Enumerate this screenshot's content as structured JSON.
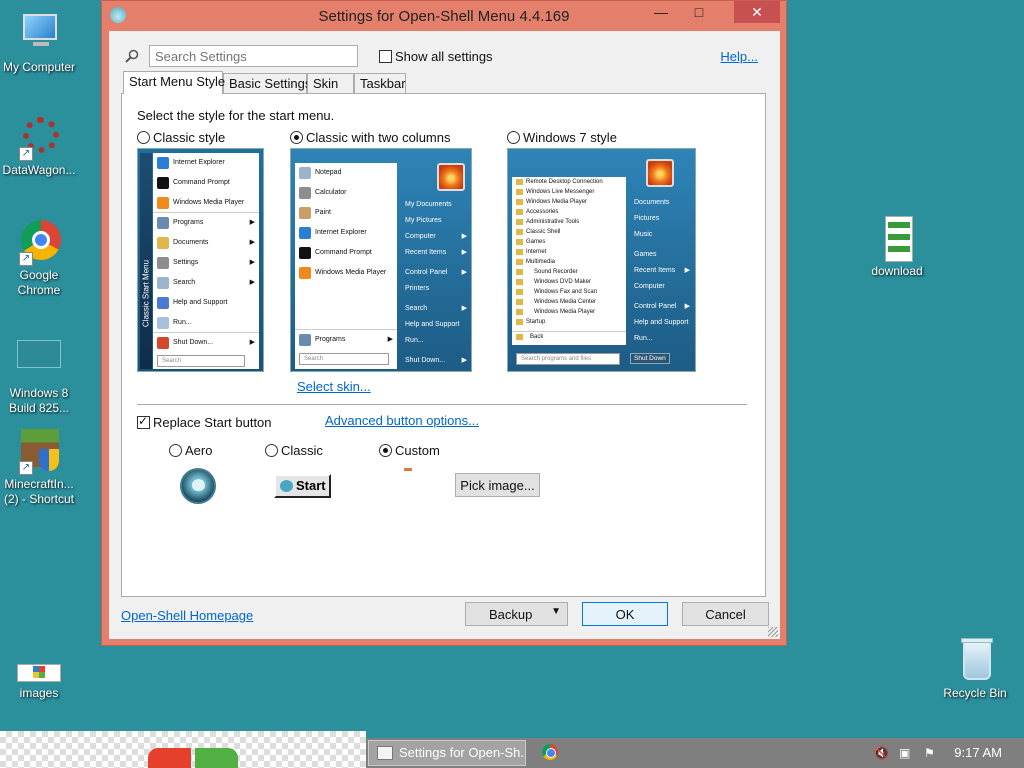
{
  "window": {
    "title": "Settings for Open-Shell Menu 4.4.169",
    "min_label": "—",
    "max_label": "□",
    "close_label": "✕"
  },
  "search": {
    "placeholder": "Search Settings"
  },
  "show_all": {
    "label": "Show all settings",
    "checked": false
  },
  "help_link": "Help...",
  "tabs": [
    {
      "label": "Start Menu Style",
      "active": true
    },
    {
      "label": "Basic Settings",
      "active": false
    },
    {
      "label": "Skin",
      "active": false
    },
    {
      "label": "Taskbar",
      "active": false
    }
  ],
  "style_prompt": "Select the style for the start menu.",
  "styles": [
    {
      "label": "Classic style",
      "selected": false
    },
    {
      "label": "Classic with two columns",
      "selected": true
    },
    {
      "label": "Windows 7 style",
      "selected": false
    }
  ],
  "preview_classic": {
    "side_label": "Classic Start Menu",
    "items": [
      "Internet Explorer",
      "Command Prompt",
      "Windows Media Player",
      "Programs",
      "Documents",
      "Settings",
      "Search",
      "Help and Support",
      "Run...",
      "Shut Down..."
    ],
    "search": "Search"
  },
  "preview_two_col": {
    "left_items": [
      "Notepad",
      "Calculator",
      "Paint",
      "Internet Explorer",
      "Command Prompt",
      "Windows Media Player"
    ],
    "programs": "Programs",
    "right_items": [
      "My Documents",
      "My Pictures",
      "Computer",
      "Recent Items",
      "Control Panel",
      "Printers",
      "Search",
      "Help and Support",
      "Run...",
      "Shut Down..."
    ],
    "search": "Search"
  },
  "preview_win7": {
    "left_items": [
      "Remote Desktop Connection",
      "Windows Live Messenger",
      "Windows Media Player",
      "Accessories",
      "Administrative Tools",
      "Classic Shell",
      "Games",
      "Internet",
      "Multimedia",
      "Sound Recorder",
      "Windows DVD Maker",
      "Windows Fax and Scan",
      "Windows Media Center",
      "Windows Media Player",
      "Startup"
    ],
    "back": "Back",
    "search": "Search programs and files",
    "right_items": [
      "Documents",
      "Pictures",
      "Music",
      "Games",
      "Recent Items",
      "Computer",
      "Control Panel",
      "Help and Support",
      "Run..."
    ],
    "shutdown": "Shut Down"
  },
  "select_skin_link": "Select skin...",
  "replace_start": {
    "label": "Replace Start button",
    "checked": true
  },
  "advanced_link": "Advanced button options...",
  "button_styles": [
    {
      "label": "Aero",
      "selected": false
    },
    {
      "label": "Classic",
      "selected": false
    },
    {
      "label": "Custom",
      "selected": true
    }
  ],
  "classic_button_label": "Start",
  "pick_image_label": "Pick image...",
  "homepage_link": "Open-Shell Homepage",
  "backup_label": "Backup",
  "ok_label": "OK",
  "cancel_label": "Cancel",
  "desktop_icons": [
    {
      "label": "My Computer"
    },
    {
      "label": "DataWagon..."
    },
    {
      "label": "Google Chrome"
    },
    {
      "label": "Windows 8 Build 825..."
    },
    {
      "label": "MinecraftIn... (2) - Shortcut"
    },
    {
      "label": "download"
    },
    {
      "label": "images"
    },
    {
      "label": "Recycle Bin"
    }
  ],
  "taskbar": {
    "task_label": "Settings for Open-Sh...",
    "clock": "9:17 AM"
  },
  "colors": {
    "desktop": "#2b8f9c",
    "window_frame": "#e47f6b",
    "close_button": "#c75050",
    "link": "#0066cc",
    "taskbar": "#7f7f7f"
  }
}
